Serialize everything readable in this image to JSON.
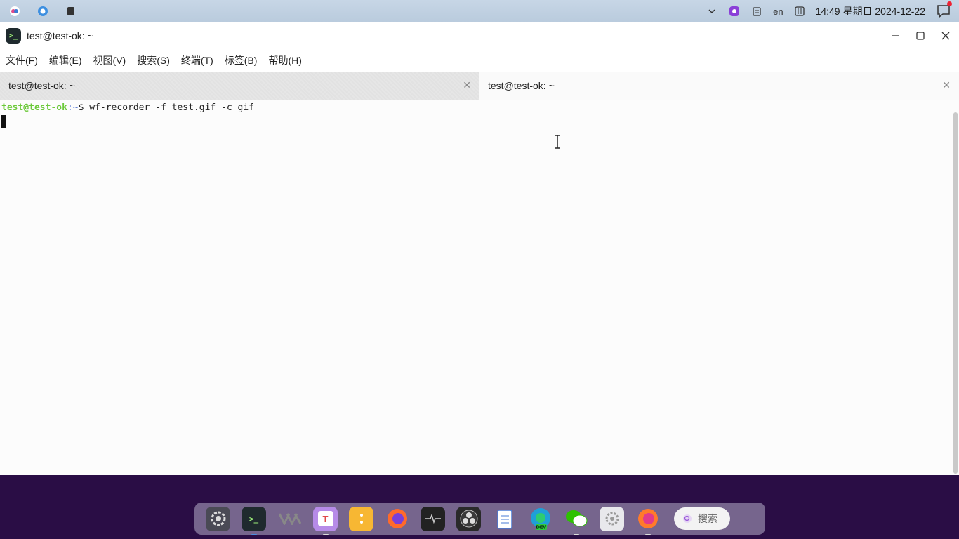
{
  "system_tray": {
    "left_icons": [
      "kylin-logo-icon",
      "browser-icon",
      "app-icon"
    ],
    "right_icons": [
      "chevron-down-icon",
      "screen-recorder-icon",
      "clipboard-icon"
    ],
    "language": "en",
    "clock": "14:49 星期日 2024-12-22"
  },
  "window": {
    "title": "test@test-ok: ~",
    "app_icon_glyph": ">_"
  },
  "menu": {
    "items": [
      "文件(F)",
      "编辑(E)",
      "视图(V)",
      "搜索(S)",
      "终端(T)",
      "标签(B)",
      "帮助(H)"
    ]
  },
  "tabs": [
    {
      "label": "test@test-ok: ~",
      "active": false
    },
    {
      "label": "test@test-ok: ~",
      "active": true
    }
  ],
  "terminal": {
    "prompt_user": "test@test-ok",
    "prompt_path": ":~",
    "prompt_symbol": "$",
    "command": " wf-recorder -f test.gif -c gif"
  },
  "dock": {
    "apps": [
      "settings-icon",
      "terminal-icon",
      "vim-icon",
      "text-editor-icon",
      "notes-icon",
      "firefox-icon",
      "system-monitor-icon",
      "obs-icon",
      "clipboard-app-icon",
      "edge-dev-icon",
      "wechat-icon",
      "control-center-icon",
      "firefox-alt-icon"
    ],
    "search_label": "搜索"
  },
  "colors": {
    "prompt_user": "#6cc93a",
    "prompt_path": "#4a6fd1",
    "desktop": "#2a0d45"
  }
}
